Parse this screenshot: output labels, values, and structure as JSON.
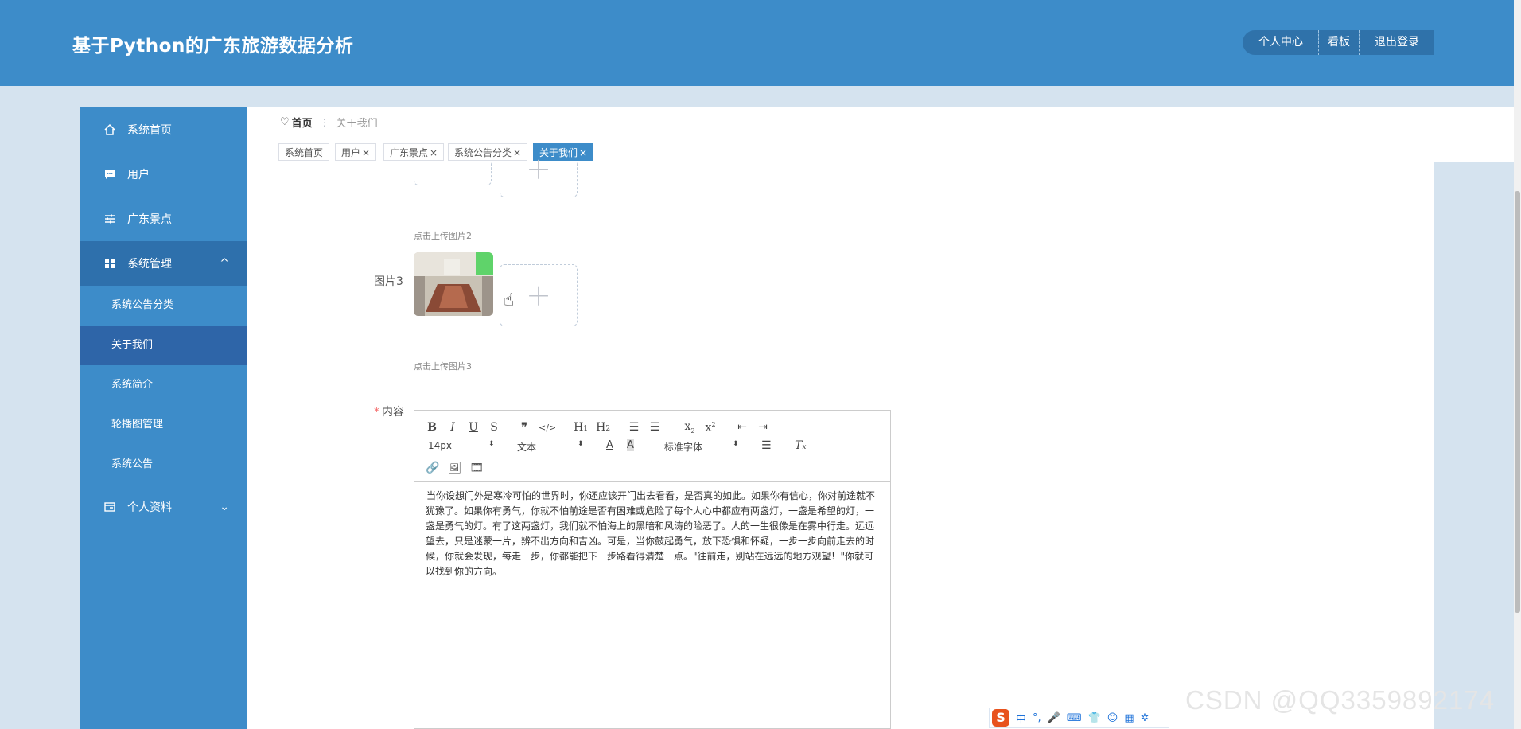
{
  "app": {
    "title": "基于Python的广东旅游数据分析",
    "brand_color": "#3d8cc9"
  },
  "top_nav": {
    "items": [
      "个人中心",
      "看板",
      "退出登录"
    ]
  },
  "sidebar": {
    "items": [
      {
        "label": "系统首页",
        "icon": "home-icon"
      },
      {
        "label": "用户",
        "icon": "chat-icon"
      },
      {
        "label": "广东景点",
        "icon": "sliders-icon"
      },
      {
        "label": "系统管理",
        "icon": "grid-icon",
        "chevron": "^"
      },
      {
        "label": "个人资料",
        "icon": "card-icon",
        "chevron": "⌄"
      }
    ],
    "submenu": [
      "系统公告分类",
      "关于我们",
      "系统简介",
      "轮播图管理",
      "系统公告"
    ]
  },
  "breadcrumb": {
    "home": "首页",
    "current": "关于我们"
  },
  "tags": [
    {
      "label": "系统首页",
      "closable": false
    },
    {
      "label": "用户",
      "closable": true
    },
    {
      "label": "广东景点",
      "closable": true
    },
    {
      "label": "系统公告分类",
      "closable": true
    },
    {
      "label": "关于我们",
      "closable": true,
      "active": true
    }
  ],
  "form": {
    "upload_hint_2": "点击上传图片2",
    "picture3_label": "图片3",
    "upload_hint_3": "点击上传图片3",
    "content_label": "内容",
    "required_mark": "*"
  },
  "editor": {
    "font_size": "14px",
    "heading": "文本",
    "font_family": "标准字体",
    "content": "当你设想门外是寒冷可怕的世界时，你还应该开门出去看看，是否真的如此。如果你有信心，你对前途就不犹豫了。如果你有勇气，你就不怕前途是否有困难或危险了每个人心中都应有两盏灯，一盏是希望的灯，一盏是勇气的灯。有了这两盏灯，我们就不怕海上的黑暗和风涛的险恶了。人的一生很像是在雾中行走。远远望去，只是迷蒙一片，辨不出方向和吉凶。可是，当你鼓起勇气，放下恐惧和怀疑，一步一步向前走去的时候，你就会发现，每走一步，你都能把下一步路看得清楚一点。\"往前走，别站在远远的地方观望！\"你就可以找到你的方向。"
  },
  "ime": {
    "logo": "S",
    "items": [
      "中",
      "°,",
      "🎤",
      "⌨",
      "👕",
      "☺",
      "▦",
      "✲"
    ]
  },
  "watermark": "CSDN @QQ3359892174"
}
